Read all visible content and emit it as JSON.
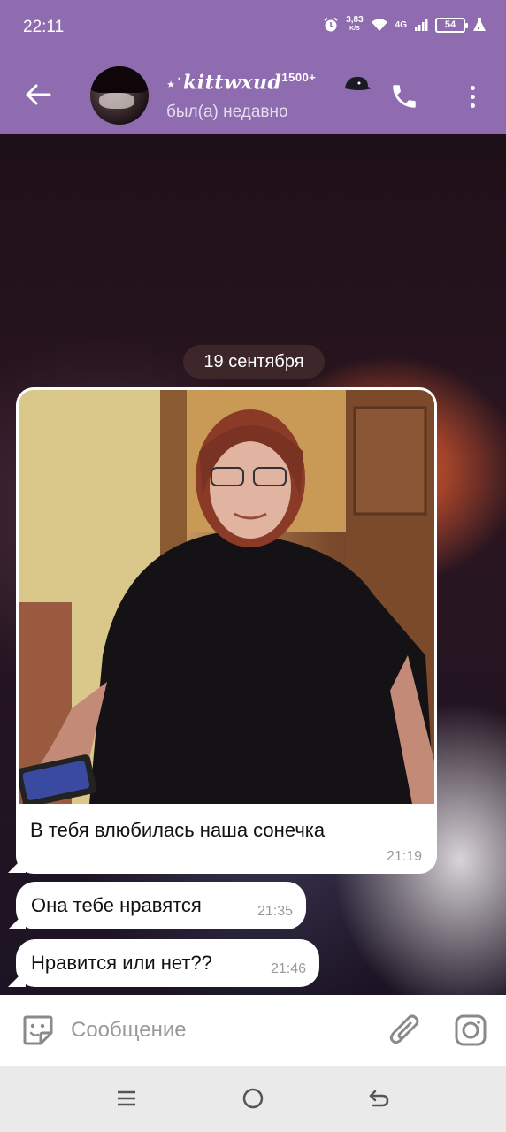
{
  "status_bar": {
    "time": "22:11",
    "net_speed_value": "3,83",
    "net_speed_unit": "K/S",
    "network": "4G",
    "battery": "54"
  },
  "header": {
    "contact_name": "kittwxud",
    "contact_badge": "1500+",
    "contact_status": "был(а) недавно",
    "colors": {
      "bar": "#8f6bb0"
    },
    "icons": [
      "back-arrow-icon",
      "phone-icon",
      "more-vertical-icon"
    ]
  },
  "chat": {
    "date_label": "19 сентября",
    "photo_message": {
      "caption": "В тебя влюбилась наша сонечка",
      "time": "21:19"
    },
    "messages": [
      {
        "text": "Она тебе нравятся",
        "time": "21:35"
      },
      {
        "text": "Нравится или нет??",
        "time": "21:46"
      }
    ]
  },
  "composer": {
    "placeholder": "Сообщение",
    "icons": [
      "sticker-icon",
      "paperclip-icon",
      "camera-icon"
    ]
  },
  "nav": {
    "icons": [
      "recent-apps-icon",
      "home-icon",
      "back-icon"
    ]
  }
}
